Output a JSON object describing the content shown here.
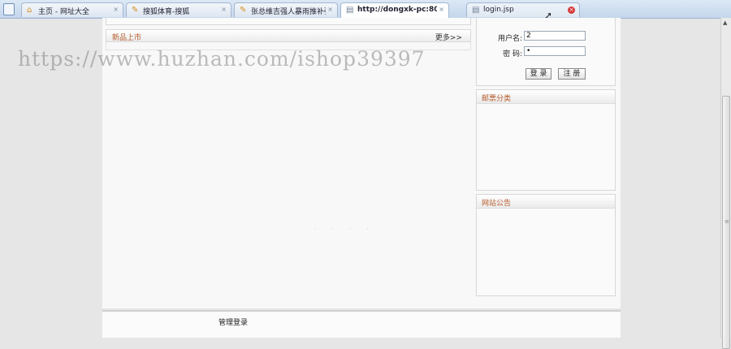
{
  "browser": {
    "tabs": [
      {
        "label": "主页 - 网址大全",
        "close": "×"
      },
      {
        "label": "搜狐体育-搜狐",
        "close": "×"
      },
      {
        "label": "张总维吉强人暴雨推补强...",
        "close": "×"
      },
      {
        "label": "http://dongxk-pc:808...",
        "close": "×"
      },
      {
        "label": "login.jsp",
        "close": "×"
      }
    ]
  },
  "main": {
    "new_arrivals": {
      "title": "新品上市",
      "more": "更多>>"
    },
    "faint_text": "· · · ·"
  },
  "login": {
    "username_label": "用户名:",
    "username_value": "2",
    "password_label": "密  码:",
    "password_value": "•",
    "login_button": "登 录",
    "register_button": "注 册"
  },
  "sidebar": {
    "category_title": "邮票分类",
    "announcement_title": "网站公告"
  },
  "footer": {
    "admin_link": "管理登录"
  },
  "watermark": "https://www.huzhan.com/ishop39397",
  "colors": {
    "panel_title": "#b45a2a",
    "tab_bar": "#c4d6ec"
  }
}
